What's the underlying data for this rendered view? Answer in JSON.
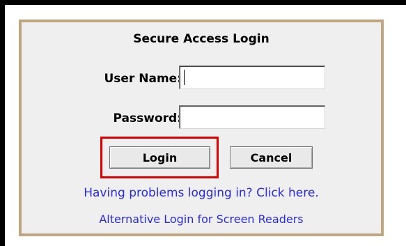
{
  "login_panel": {
    "title": "Secure Access Login",
    "username_label": "User Name:",
    "username_value": "",
    "password_label": "Password:",
    "password_value": "",
    "login_button": "Login",
    "cancel_button": "Cancel",
    "help_link": "Having problems logging in? Click here.",
    "alt_login_link": "Alternative Login for Screen Readers"
  },
  "colors": {
    "panel_background": "#efefef",
    "panel_border": "#bfa67e",
    "link": "#2a2ae0",
    "highlight_box": "#e00000"
  }
}
